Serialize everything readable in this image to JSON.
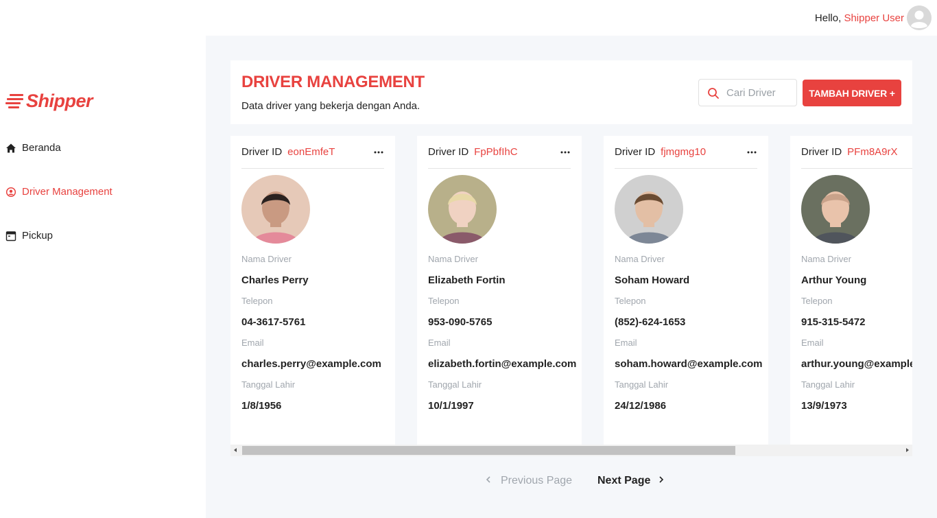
{
  "header": {
    "greeting": "Hello,",
    "user_name": "Shipper User"
  },
  "brand": {
    "name": "Shipper",
    "color": "#e8423f"
  },
  "sidebar": {
    "items": [
      {
        "label": "Beranda",
        "icon": "home-icon",
        "active": false
      },
      {
        "label": "Driver Management",
        "icon": "user-circle-icon",
        "active": true
      },
      {
        "label": "Pickup",
        "icon": "calendar-icon",
        "active": false
      }
    ]
  },
  "main": {
    "title": "DRIVER MANAGEMENT",
    "subtitle": "Data driver yang bekerja dengan Anda.",
    "search": {
      "placeholder": "Cari Driver",
      "value": ""
    },
    "add_button": "TAMBAH DRIVER +"
  },
  "card_labels": {
    "driver_id": "Driver ID",
    "name": "Nama Driver",
    "phone": "Telepon",
    "email": "Email",
    "birthdate": "Tanggal Lahir"
  },
  "drivers": [
    {
      "id": "eonEmfeT",
      "name": "Charles Perry",
      "phone": "04-3617-5761",
      "email": "charles.perry@example.com",
      "birthdate": "1/8/1956"
    },
    {
      "id": "FpPbfIhC",
      "name": "Elizabeth Fortin",
      "phone": "953-090-5765",
      "email": "elizabeth.fortin@example.com",
      "birthdate": "10/1/1997"
    },
    {
      "id": "fjmgmg10",
      "name": "Soham Howard",
      "phone": "(852)-624-1653",
      "email": "soham.howard@example.com",
      "birthdate": "24/12/1986"
    },
    {
      "id": "PFm8A9rX",
      "name": "Arthur Young",
      "phone": "915-315-5472",
      "email": "arthur.young@example.com",
      "birthdate": "13/9/1973"
    }
  ],
  "pagination": {
    "prev_label": "Previous Page",
    "next_label": "Next Page"
  },
  "colors": {
    "accent": "#e8423f",
    "main_bg": "#f5f7fa",
    "muted": "#a0a6ad"
  }
}
